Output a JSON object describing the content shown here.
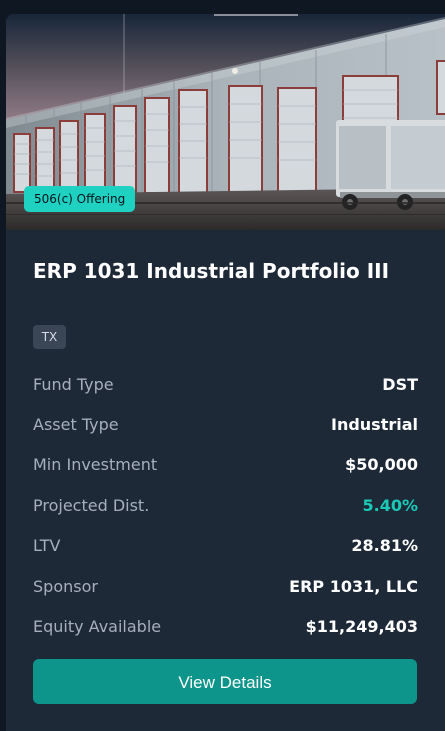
{
  "card": {
    "offering_badge": "506(c) Offering",
    "title": "ERP 1031 Industrial Portfolio III",
    "state_tag": "TX",
    "fields": [
      {
        "label": "Fund Type",
        "value": "DST"
      },
      {
        "label": "Asset Type",
        "value": "Industrial"
      },
      {
        "label": "Min Investment",
        "value": "$50,000"
      },
      {
        "label": "Projected Dist.",
        "value": "5.40%"
      },
      {
        "label": "LTV",
        "value": "28.81%"
      },
      {
        "label": "Sponsor",
        "value": "ERP 1031, LLC"
      },
      {
        "label": "Equity Available",
        "value": "$11,249,403"
      }
    ],
    "cta_label": "View Details"
  },
  "colors": {
    "page_background": "#0f1722",
    "card_background": "#1e2938",
    "accent": "#1ac9b6",
    "badge_background": "#1ed1c0",
    "button_background": "#0d958b"
  },
  "icons": {
    "hero_image": "industrial-warehouse-photo"
  }
}
